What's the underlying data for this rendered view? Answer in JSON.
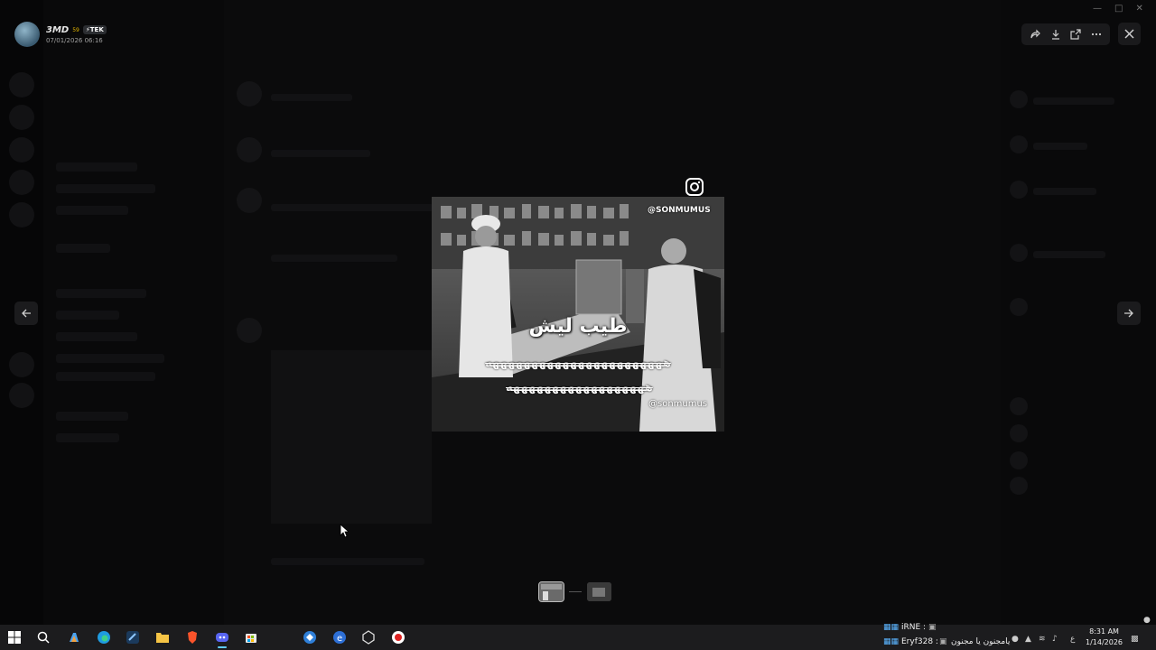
{
  "uploader": {
    "name": "3MD",
    "name_sup": "59",
    "tag": "⚡TEK",
    "timestamp": "07/01/2026 06:16"
  },
  "toolbar": {
    "forward_icon": "forward-icon",
    "download_icon": "download-icon",
    "open_external_icon": "open-external-icon",
    "more_icon": "more-icon",
    "close_icon": "close-icon"
  },
  "media": {
    "watermark_top": "@SONMUMUS",
    "watermark_bottom": "@sonmumus",
    "caption_main": "طيب ليش",
    "caption_laugh_1": "هههههههههههههههههههههههه",
    "caption_laugh_2": "ههههههههههههههههههه"
  },
  "taskbar": {
    "tray_user_1": "iRNE :",
    "tray_user_2": "Eryf328 :",
    "tray_message": "يامجنون يا مجنون",
    "clock_time": "8:31 AM",
    "clock_date": "1/14/2026"
  },
  "colors": {
    "backdrop": "#000000",
    "panel": "#1a1a1c",
    "accent": "#60cdff"
  }
}
